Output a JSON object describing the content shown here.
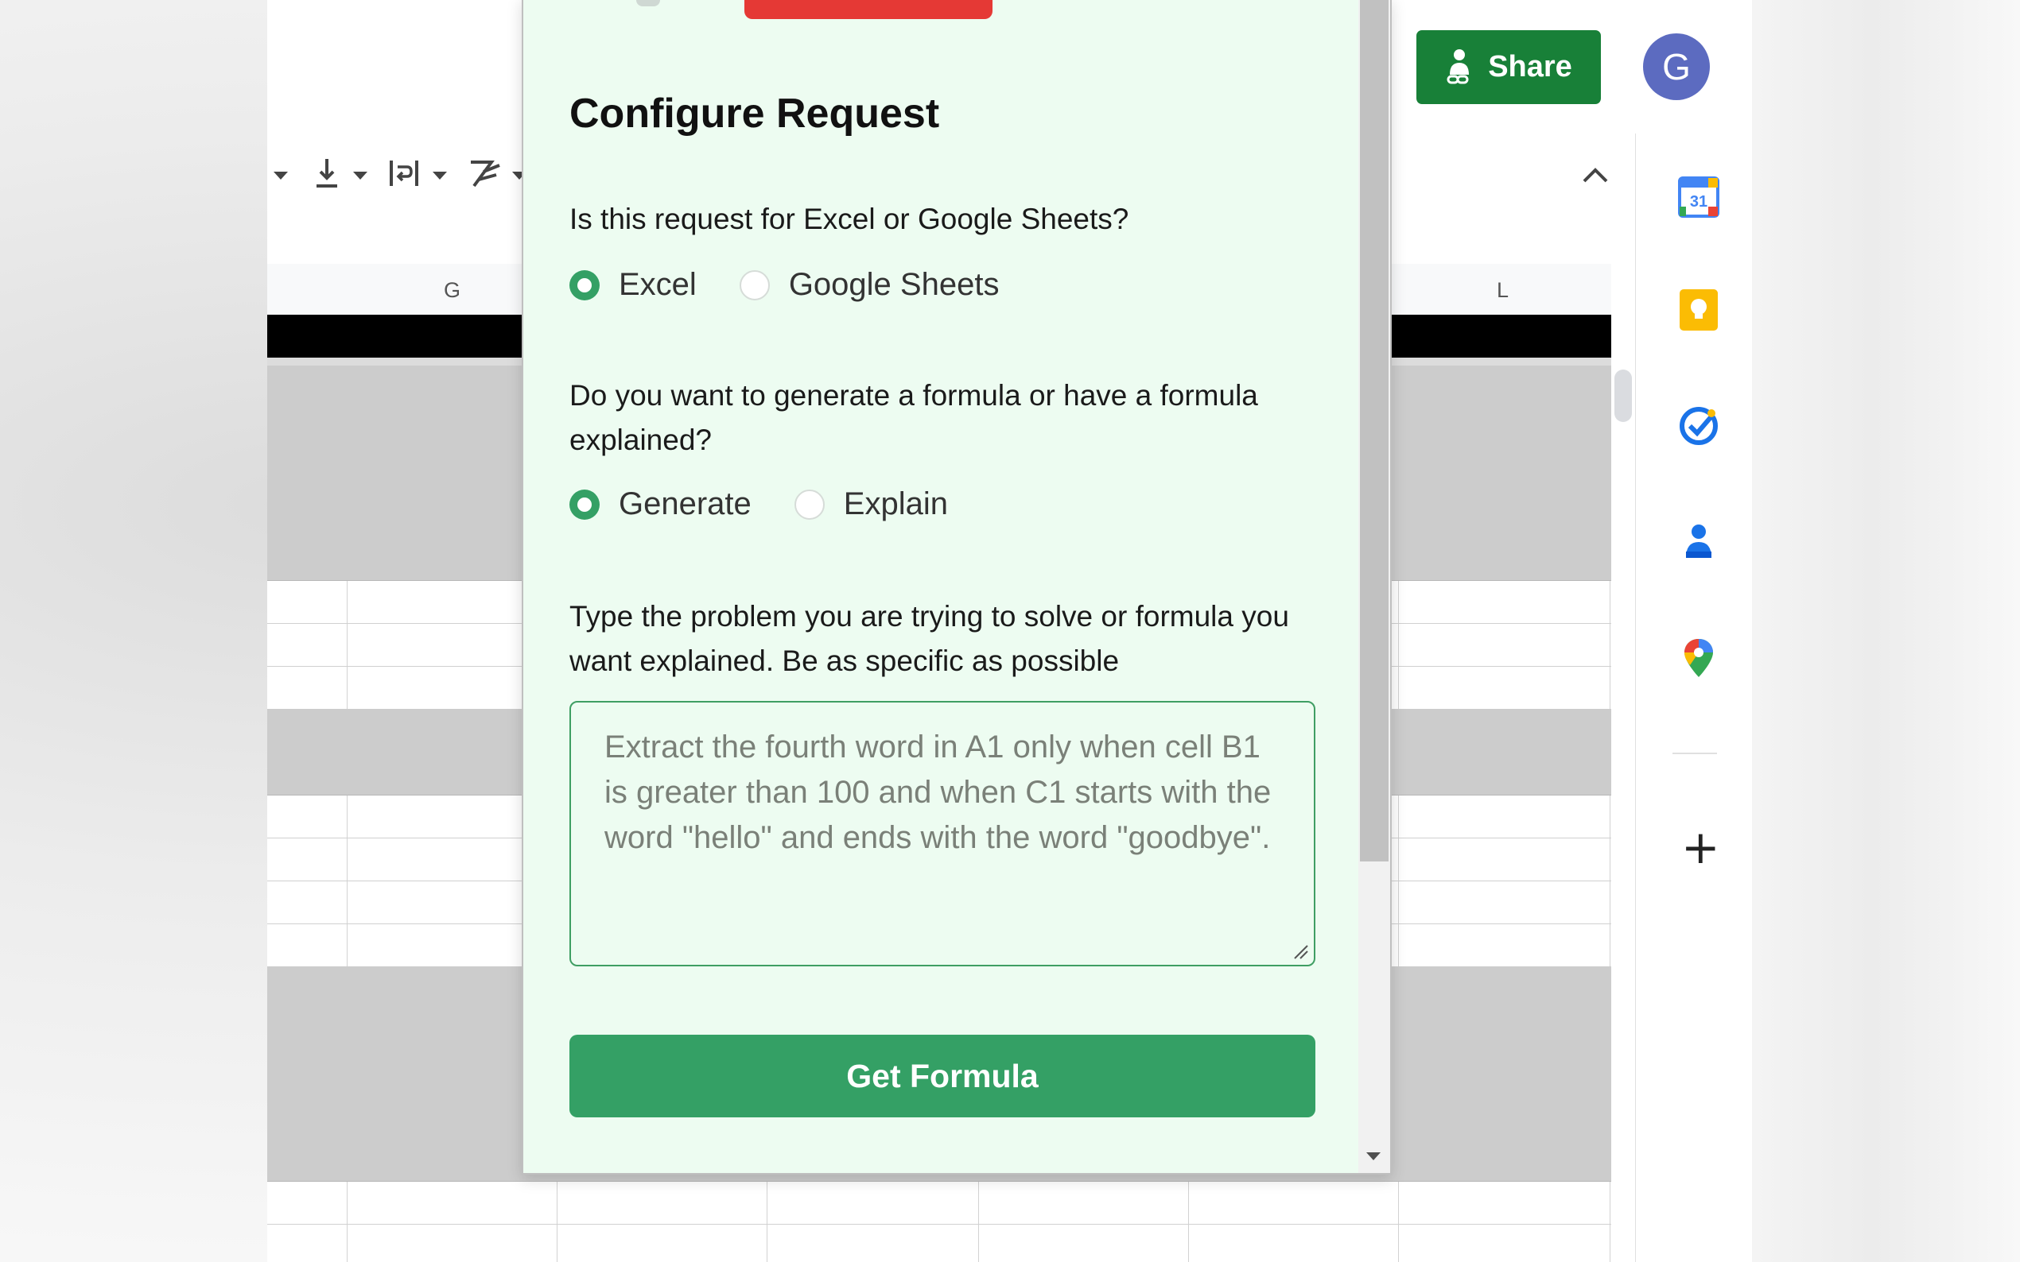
{
  "header": {
    "share_label": "Share",
    "avatar_initial": "G"
  },
  "grid": {
    "columns": [
      "G",
      "L"
    ]
  },
  "side_panel": {
    "icons": [
      "calendar-icon",
      "keep-icon",
      "tasks-icon",
      "contacts-icon",
      "maps-icon"
    ],
    "calendar_day": "31",
    "add_label": "+"
  },
  "popup": {
    "title": "Configure Request",
    "platform_question": "Is this request for Excel or Google Sheets?",
    "platform_options": [
      {
        "label": "Excel",
        "checked": true
      },
      {
        "label": "Google Sheets",
        "checked": false
      }
    ],
    "mode_question": "Do you want to generate a formula or have a formula explained?",
    "mode_options": [
      {
        "label": "Generate",
        "checked": true
      },
      {
        "label": "Explain",
        "checked": false
      }
    ],
    "problem_question": "Type the problem you are trying to solve or formula you want explained. Be as specific as possible",
    "problem_placeholder": "Extract the fourth word in A1 only when cell B1 is greater than 100 and when C1 starts with the word \"hello\" and ends with the word \"goodbye\".",
    "problem_value": "",
    "submit_label": "Get Formula"
  },
  "colors": {
    "accent_green": "#34a065",
    "share_green": "#188038",
    "popup_bg": "#edfcf1",
    "alert_red": "#e53935",
    "avatar_bg": "#5c6bc0"
  }
}
